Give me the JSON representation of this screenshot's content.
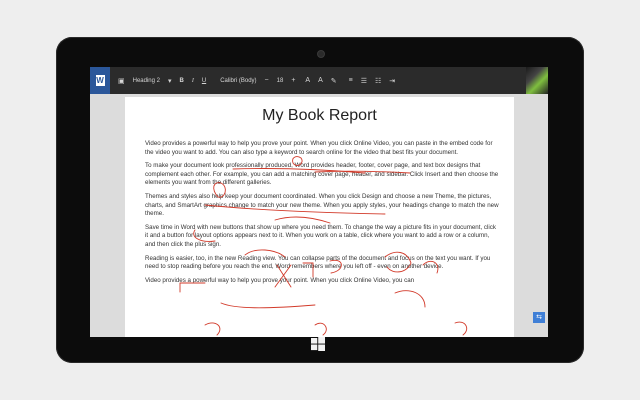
{
  "app": {
    "icon": "word-icon",
    "tile_letter": "W"
  },
  "toolbar": {
    "style": "Heading 2",
    "bold": "B",
    "italic": "I",
    "underline": "U",
    "font": "Calibri (Body)",
    "size": "18"
  },
  "document": {
    "title": "My Book Report",
    "paragraphs": [
      "Video provides a powerful way to help you prove your point. When you click Online Video, you can paste in the embed code for the video you want to add. You can also type a keyword to search online for the video that best fits your document.",
      "To make your document look professionally produced, Word provides header, footer, cover page, and text box designs that complement each other. For example, you can add a matching cover page, header, and sidebar. Click Insert and then choose the elements you want from the different galleries.",
      "Themes and styles also help keep your document coordinated. When you click Design and choose a new Theme, the pictures, charts, and SmartArt graphics change to match your new theme. When you apply styles, your headings change to match the new theme.",
      "Save time in Word with new buttons that show up where you need them. To change the way a picture fits in your document, click it and a button for layout options appears next to it. When you work on a table, click where you want to add a row or a column, and then click the plus sign.",
      "Reading is easier, too, in the new Reading view. You can collapse parts of the document and focus on the text you want. If you need to stop reading before you reach the end, Word remembers where you left off - even on another device.",
      "Video provides a powerful way to help you prove your point. When you click Online Video, you can"
    ]
  },
  "colors": {
    "word_blue": "#2b579a",
    "ribbon": "#2b2b2b",
    "ink": "#d23a2a"
  }
}
